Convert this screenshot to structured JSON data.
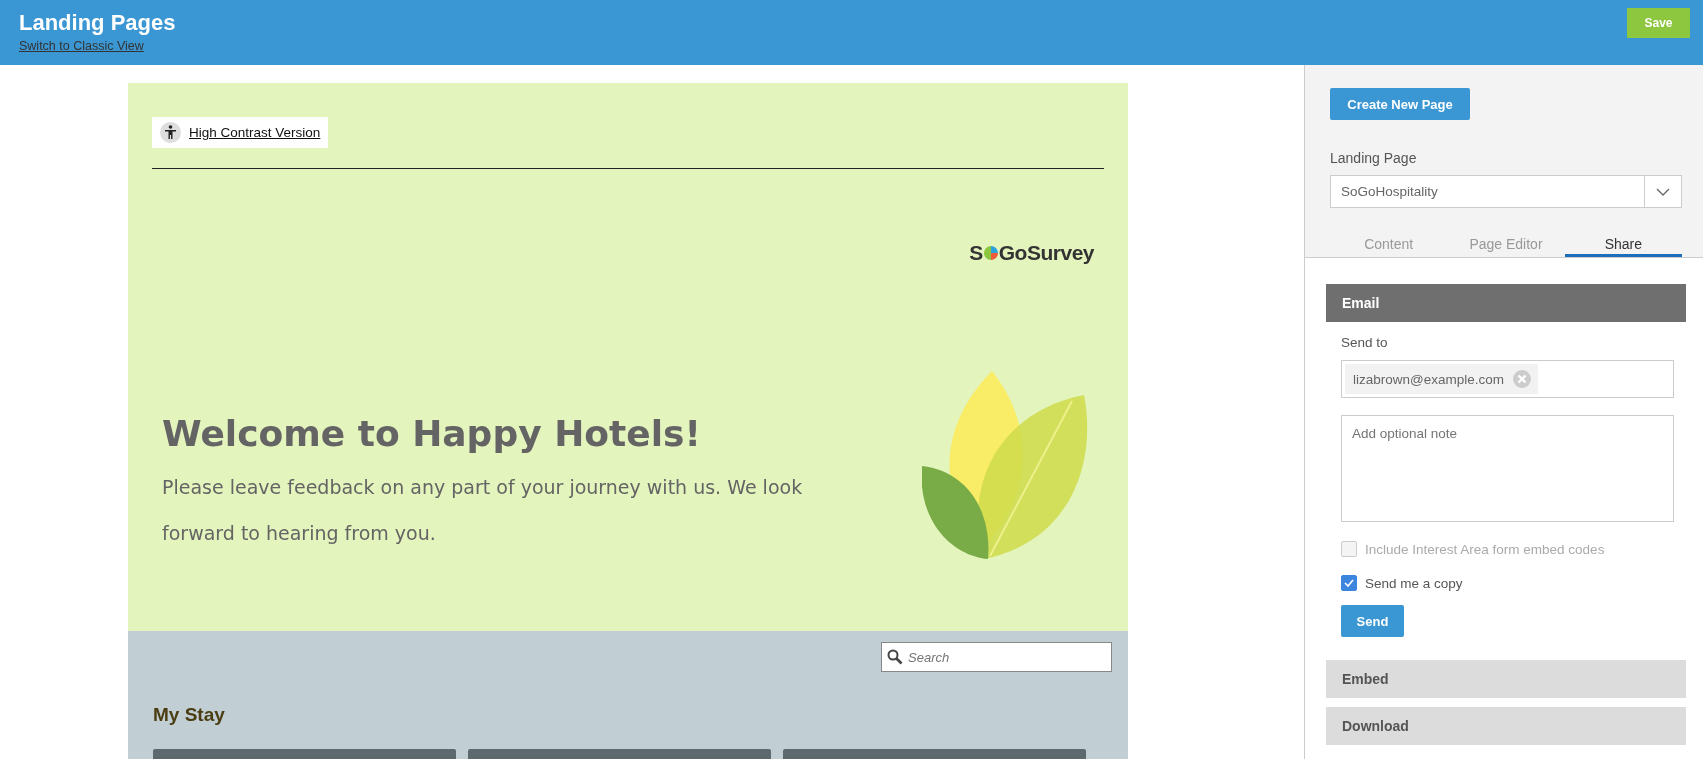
{
  "header": {
    "title": "Landing Pages",
    "link": "Switch to Classic View",
    "save_button": "Save"
  },
  "preview": {
    "contrast_link": "High Contrast Version",
    "logo": {
      "before": "S",
      "after": "GoSurvey"
    },
    "heading": "Welcome to Happy Hotels!",
    "intro": "Please leave feedback on any part of your journey with us. We look forward to hearing from you.",
    "search": {
      "placeholder": "Search"
    },
    "section_title": "My Stay"
  },
  "panel": {
    "create_button": "Create New Page",
    "landing_page": {
      "label": "Landing Page",
      "value": "SoGoHospitality"
    },
    "tabs": [
      {
        "label": "Content",
        "selected": false
      },
      {
        "label": "Page Editor",
        "selected": false
      },
      {
        "label": "Share",
        "selected": true
      }
    ],
    "sections": [
      {
        "title": "Email",
        "expanded": true
      },
      {
        "title": "Embed",
        "expanded": false
      },
      {
        "title": "Download",
        "expanded": false
      }
    ],
    "email": {
      "send_to_label": "Send to",
      "recipients": [
        "lizabrown@example.com"
      ],
      "note": {
        "placeholder": "Add optional note"
      },
      "options": [
        {
          "label": "Include Interest Area form embed codes",
          "checked": false,
          "disabled": true
        },
        {
          "label": "Send me a copy",
          "checked": true,
          "disabled": false
        }
      ],
      "send_button": "Send"
    }
  }
}
